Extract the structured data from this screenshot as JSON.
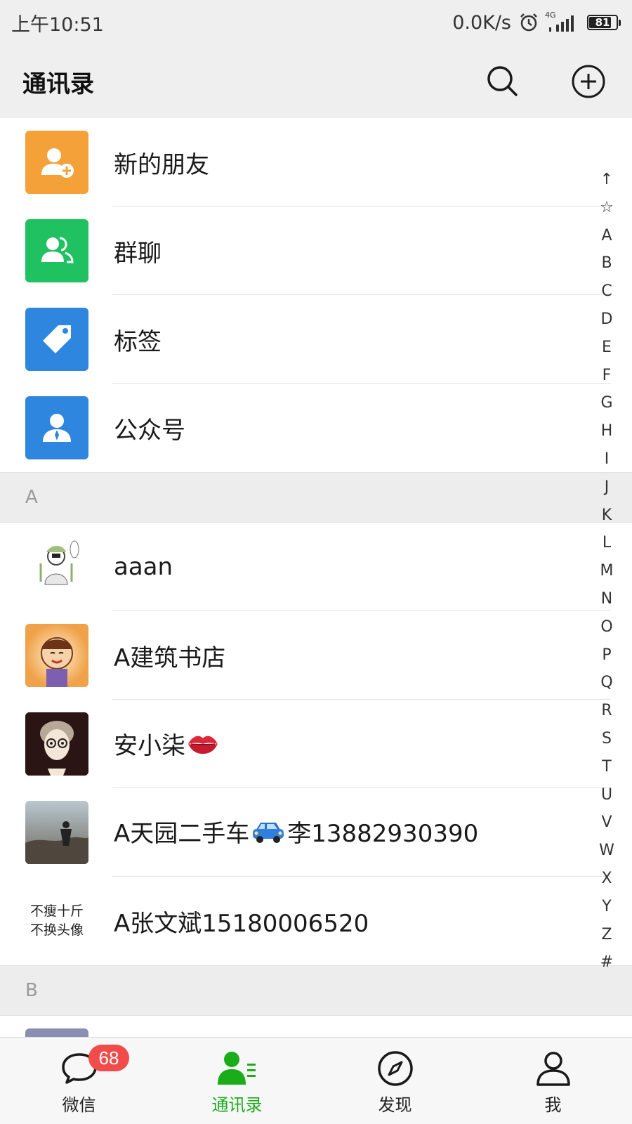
{
  "status_bar": {
    "time": "上午10:51",
    "net_speed": "0.0K/s",
    "network": "4G",
    "battery": "81"
  },
  "header": {
    "title": "通讯录",
    "search_icon": "search-icon",
    "add_icon": "plus-circle-icon"
  },
  "special_items": [
    {
      "label": "新的朋友",
      "icon": "add-friend-icon",
      "color": "#f5a13a"
    },
    {
      "label": "群聊",
      "icon": "group-chat-icon",
      "color": "#1fc160"
    },
    {
      "label": "标签",
      "icon": "tag-icon",
      "color": "#2f86de"
    },
    {
      "label": "公众号",
      "icon": "official-account-icon",
      "color": "#2f86de"
    }
  ],
  "sections": [
    {
      "letter": "A",
      "contacts": [
        {
          "name": "aaan"
        },
        {
          "name": "A建筑书店"
        },
        {
          "name_before": "安小柒",
          "emoji": "kiss-mark-emoji"
        },
        {
          "name_before": "A天园二手车",
          "emoji": "car-emoji",
          "name_after": "李13882930390"
        },
        {
          "name": "A张文斌15180006520",
          "avatar_text_line1": "不瘦十斤",
          "avatar_text_line2": "不换头像"
        }
      ]
    },
    {
      "letter": "B",
      "contacts": []
    }
  ],
  "index_bar": [
    "↑",
    "☆",
    "A",
    "B",
    "C",
    "D",
    "E",
    "F",
    "G",
    "H",
    "I",
    "J",
    "K",
    "L",
    "M",
    "N",
    "O",
    "P",
    "Q",
    "R",
    "S",
    "T",
    "U",
    "V",
    "W",
    "X",
    "Y",
    "Z",
    "#"
  ],
  "tab_bar": {
    "tabs": [
      {
        "label": "微信",
        "icon": "chat-bubble-icon",
        "badge": "68"
      },
      {
        "label": "通讯录",
        "icon": "contacts-icon",
        "active": true
      },
      {
        "label": "发现",
        "icon": "compass-icon"
      },
      {
        "label": "我",
        "icon": "person-icon"
      }
    ],
    "active_color": "#1aad19"
  },
  "colors": {
    "accent": "#1aad19",
    "badge": "#f24b4b",
    "header_bg": "#efefef"
  }
}
